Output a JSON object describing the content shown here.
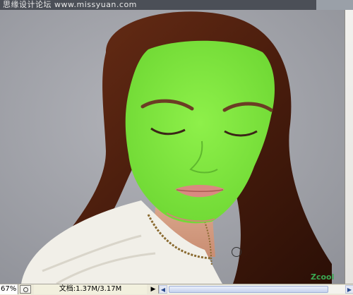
{
  "watermark_top": "思缘设计论坛 www.missyuan.com",
  "watermark_bottom": "Zcool",
  "status": {
    "zoom": "67%",
    "doc_info": "文档:1.37M/3.17M",
    "menu_arrow": "▶",
    "scroll_left": "◀",
    "scroll_right": "▶"
  },
  "canvas": {
    "mask_color": "#7fe43a",
    "background_color": "#9ea0a6"
  },
  "icons": {
    "navigator": "navigator-icon",
    "brush": "brush-cursor-icon"
  }
}
